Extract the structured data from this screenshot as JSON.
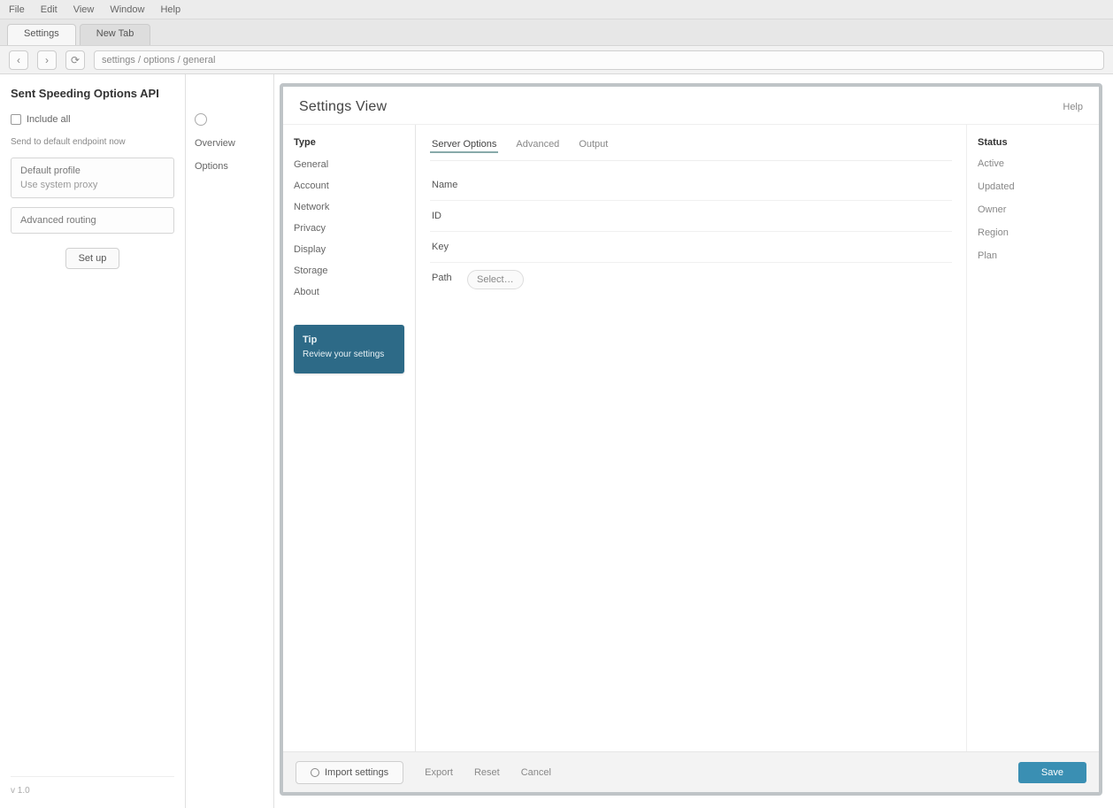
{
  "menubar": {
    "items": [
      "File",
      "Edit",
      "View",
      "Window",
      "Help"
    ]
  },
  "browser": {
    "tab_active": "Settings",
    "tab_other": "New Tab",
    "address": "settings / options / general"
  },
  "toolbar": {
    "back": "‹",
    "forward": "›",
    "reload": "⟳"
  },
  "leftPanel": {
    "title": "Sent Speeding Options API",
    "check_item": "Include all",
    "note_line": "Send to default endpoint now",
    "boxA": {
      "line1": "Default profile",
      "line2": "Use system proxy"
    },
    "boxB": {
      "line1": "Advanced routing"
    },
    "button": "Set up",
    "footer": "v 1.0"
  },
  "midPanel": {
    "item1": "Overview",
    "item2": "Options"
  },
  "main": {
    "title": "Settings View",
    "right_link": "Help",
    "innerSide": {
      "head": "Type",
      "items": [
        "General",
        "Account",
        "Network",
        "Privacy",
        "Display",
        "Storage",
        "About"
      ]
    },
    "blueCard": {
      "title": "Tip",
      "text": "Review your settings"
    },
    "tabs": {
      "t1": "Server Options",
      "t2": "Advanced",
      "t3": "Output"
    },
    "rows": {
      "r1": {
        "label": "Name",
        "value": ""
      },
      "r2": {
        "label": "ID",
        "value": ""
      },
      "r3": {
        "label": "Key",
        "value": ""
      },
      "r4": {
        "label": "Path",
        "placeholder": "Select…"
      }
    },
    "meta": {
      "head": "Status",
      "items": [
        "Active",
        "Updated",
        "Owner",
        "Region",
        "Plan"
      ]
    },
    "footer": {
      "primary": "Import settings",
      "link1": "Export",
      "link2": "Reset",
      "link3": "Cancel",
      "action": "Save"
    }
  }
}
